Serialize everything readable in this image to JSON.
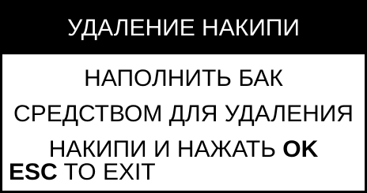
{
  "screen": {
    "title": "УДАЛЕНИЕ НАКИПИ",
    "message_lines": [
      "НАПОЛНИТЬ БАК",
      "СРЕДСТВОМ ДЛЯ УДАЛЕНИЯ",
      "НАКИПИ И НАЖАТЬ"
    ],
    "confirm_key": "OK",
    "footer_key": "ESC",
    "footer_text": "TO EXIT"
  },
  "colors": {
    "title_background": "#000000",
    "title_text": "#ffffff",
    "body_background": "#ffffff",
    "body_text": "#000000"
  }
}
